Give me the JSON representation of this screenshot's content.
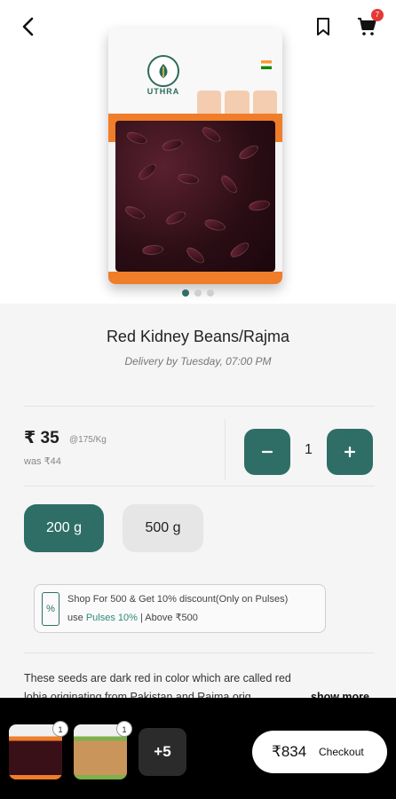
{
  "header": {
    "cart_count": "7"
  },
  "product": {
    "title": "Red Kidney Beans/Rajma",
    "delivery": "Delivery by Tuesday, 07:00 PM",
    "brand": "UTHRA",
    "price": "₹ 35",
    "unit_price": "@175/Kg",
    "was_price": "was ₹44",
    "quantity": "1",
    "image_count": 3,
    "active_image_index": 0
  },
  "variants": [
    {
      "label": "200 g",
      "selected": true
    },
    {
      "label": "500 g",
      "selected": false
    }
  ],
  "offer": {
    "line1": "Shop For 500 & Get 10% discount(Only on Pulses)",
    "use_prefix": "use",
    "code": "Pulses 10%",
    "condition": "| Above ₹500"
  },
  "description": {
    "line1": "These seeds are dark red in color which are called red",
    "line2": "lobia originating from Pakistan and Rajma orig...",
    "show_more": "show more"
  },
  "cart_bar": {
    "items": [
      {
        "qty": "1"
      },
      {
        "qty": "1"
      }
    ],
    "more_label": "+5",
    "total": "₹834",
    "checkout_label": "Checkout"
  },
  "colors": {
    "accent": "#2f6e67",
    "pack_orange": "#ef7d2a",
    "badge_red": "#e53935"
  },
  "icons": {
    "back": "chevron-left-icon",
    "bookmark": "bookmark-icon",
    "cart": "cart-icon",
    "offer": "discount-ticket-icon"
  }
}
